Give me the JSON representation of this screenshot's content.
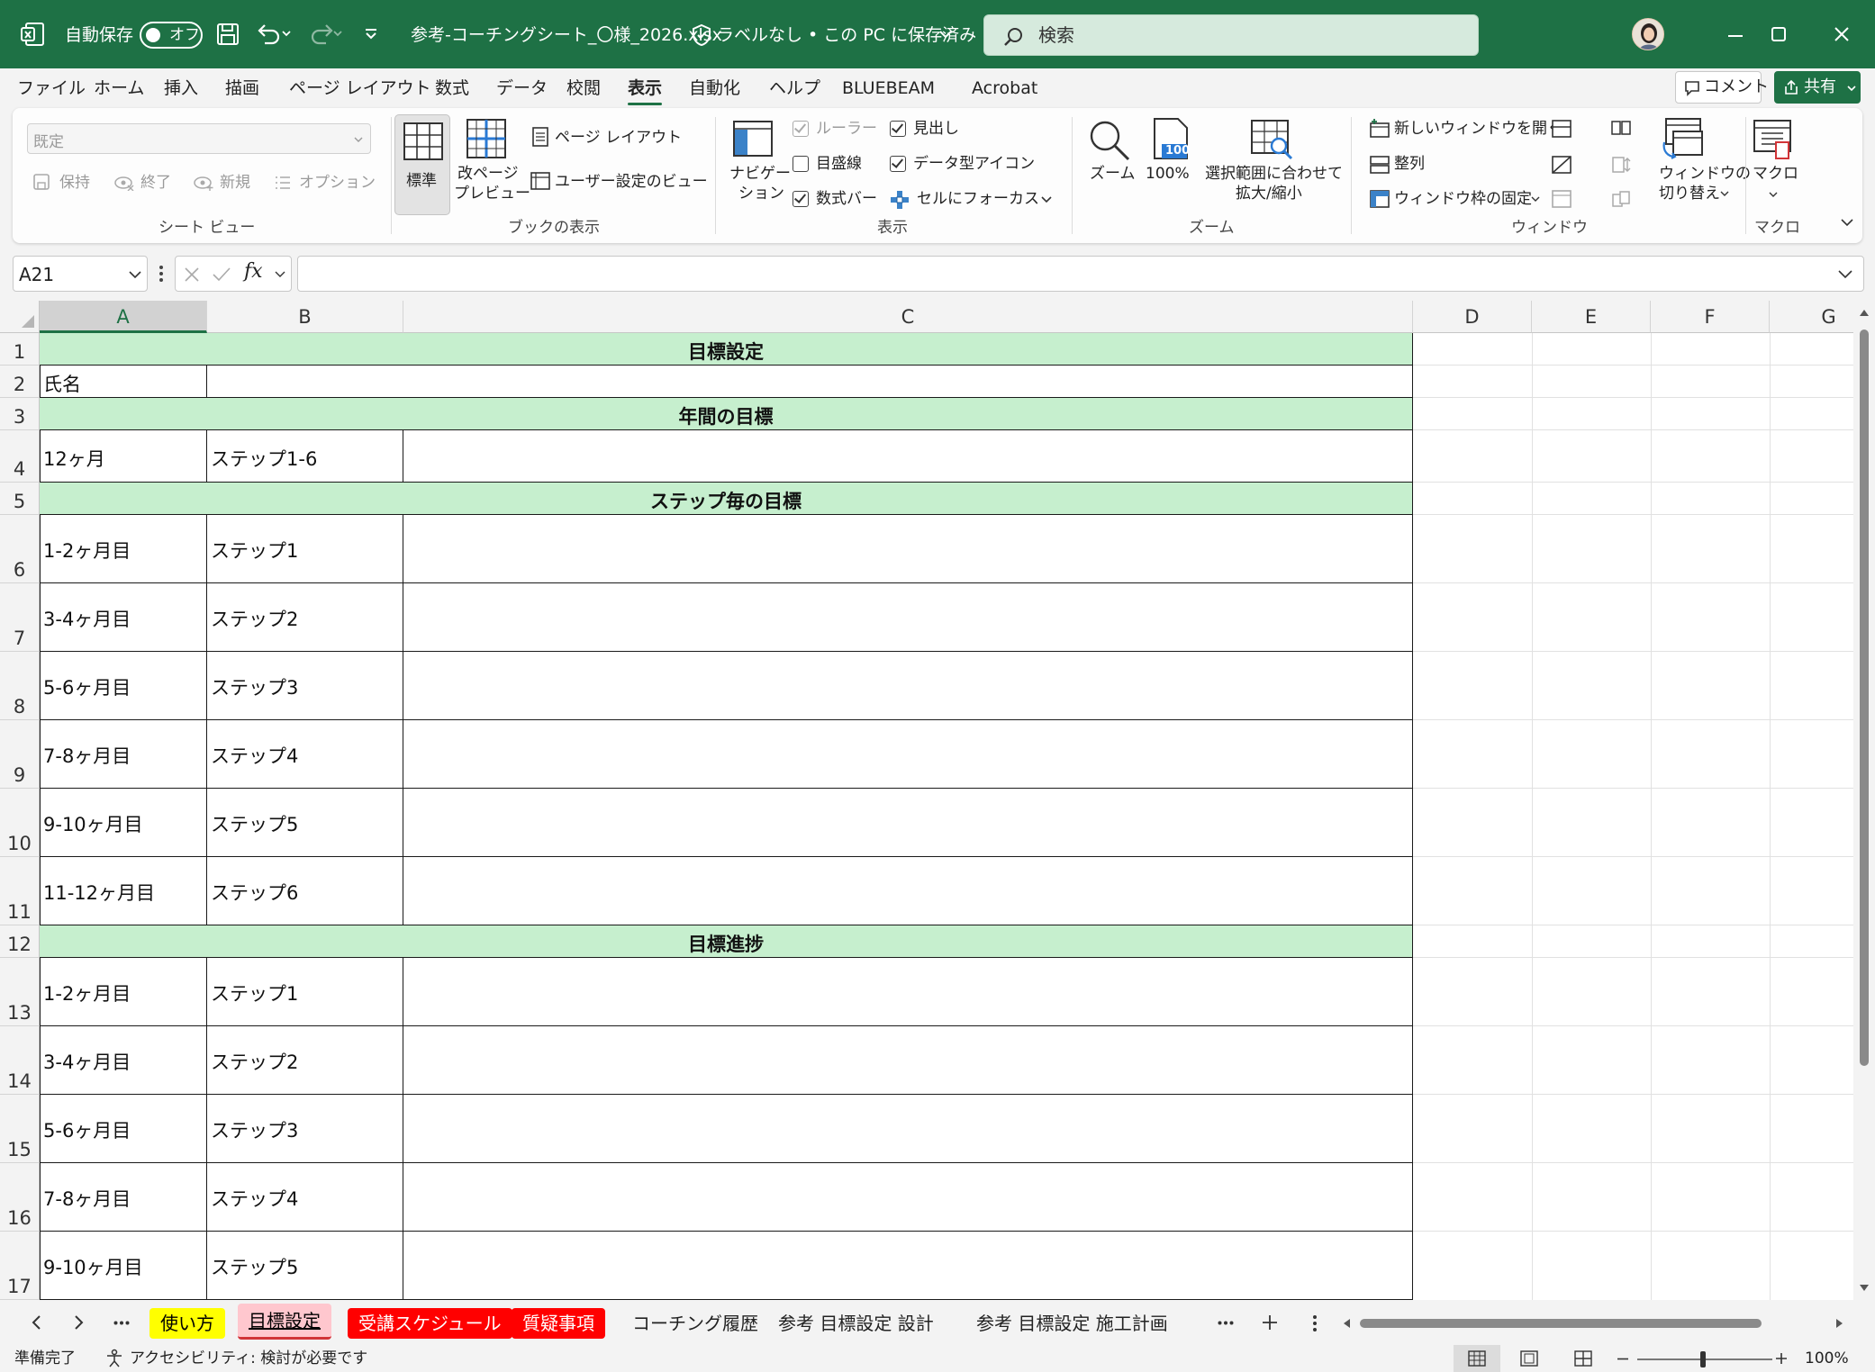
{
  "titlebar": {
    "autosave_label": "自動保存",
    "autosave_state": "オフ",
    "filename": "参考-コーチングシート_〇様_2026.xlsx",
    "label_status": "ラベルなし • この PC に保存済み",
    "search_placeholder": "検索"
  },
  "menu": {
    "items": [
      "ファイル",
      "ホーム",
      "挿入",
      "描画",
      "ページ レイアウト",
      "数式",
      "データ",
      "校閲",
      "表示",
      "自動化",
      "ヘルプ",
      "BLUEBEAM",
      "Acrobat"
    ],
    "active": "表示",
    "comment_label": "コメント",
    "share_label": "共有"
  },
  "ribbon": {
    "sheetview": {
      "dropdown_value": "既定",
      "keep": "保持",
      "exit": "終了",
      "new": "新規",
      "options": "オプション",
      "group": "シート ビュー"
    },
    "workbookviews": {
      "normal": "標準",
      "pagebreak_1": "改ページ",
      "pagebreak_2": "プレビュー",
      "pagelayout": "ページ レイアウト",
      "custom": "ユーザー設定のビュー",
      "group": "ブックの表示"
    },
    "show": {
      "nav_1": "ナビゲー",
      "nav_2": "ション",
      "ruler": "ルーラー",
      "gridlines": "目盛線",
      "formulabar": "数式バー",
      "headings": "見出し",
      "dataicon": "データ型アイコン",
      "focuscell": "セルにフォーカス",
      "group": "表示"
    },
    "zoom": {
      "zoom": "ズーム",
      "hundred": "100%",
      "icon_text": "100",
      "selection_1": "選択範囲に合わせて",
      "selection_2": "拡大/縮小",
      "group": "ズーム"
    },
    "window": {
      "newwindow": "新しいウィンドウを開く",
      "arrange": "整列",
      "freeze": "ウィンドウ枠の固定",
      "switch_1": "ウィンドウの",
      "switch_2": "切り替え",
      "group": "ウィンドウ"
    },
    "macro": {
      "macro": "マクロ",
      "group": "マクロ"
    }
  },
  "formula": {
    "namebox": "A21",
    "fx": "fx",
    "content": ""
  },
  "grid": {
    "columns": [
      "A",
      "B",
      "C",
      "D",
      "E",
      "F",
      "G"
    ],
    "selected_column": "A",
    "rows": [
      "1",
      "2",
      "3",
      "4",
      "5",
      "6",
      "7",
      "8",
      "9",
      "10",
      "11",
      "12",
      "13",
      "14",
      "15",
      "16",
      "17"
    ],
    "title": "目標設定",
    "name_label": "氏名",
    "annual_header": "年間の目標",
    "annual": {
      "a": "12ヶ月",
      "b": "ステップ1-6"
    },
    "step_header": "ステップ毎の目標",
    "steps": [
      {
        "a": "1-2ヶ月目",
        "b": "ステップ1"
      },
      {
        "a": "3-4ヶ月目",
        "b": "ステップ2"
      },
      {
        "a": "5-6ヶ月目",
        "b": "ステップ3"
      },
      {
        "a": "7-8ヶ月目",
        "b": "ステップ4"
      },
      {
        "a": "9-10ヶ月目",
        "b": "ステップ5"
      },
      {
        "a": "11-12ヶ月目",
        "b": "ステップ6"
      }
    ],
    "progress_header": "目標進捗",
    "progress": [
      {
        "a": "1-2ヶ月目",
        "b": "ステップ1"
      },
      {
        "a": "3-4ヶ月目",
        "b": "ステップ2"
      },
      {
        "a": "5-6ヶ月目",
        "b": "ステップ3"
      },
      {
        "a": "7-8ヶ月目",
        "b": "ステップ4"
      },
      {
        "a": "9-10ヶ月目",
        "b": "ステップ5"
      }
    ],
    "header_fill": "#c6efce"
  },
  "sheets": {
    "tabs": [
      {
        "label": "使い方",
        "color": "#ffff00",
        "text": "#000000"
      },
      {
        "label": "目標設定",
        "color": "#ffc7ce",
        "text": "#000000",
        "active": true
      },
      {
        "label": "受講スケジュール",
        "color": "#ff0000",
        "text": "#ffffff"
      },
      {
        "label": "質疑事項",
        "color": "#ff0000",
        "text": "#ffffff"
      },
      {
        "label": "コーチング履歴",
        "color": "",
        "text": "#222222"
      },
      {
        "label": "参考 目標設定 設計",
        "color": "",
        "text": "#222222"
      },
      {
        "label": "参考 目標設定 施工計画",
        "color": "",
        "text": "#222222"
      }
    ]
  },
  "status": {
    "ready": "準備完了",
    "accessibility": "アクセシビリティ: 検討が必要です",
    "zoom": "100%"
  },
  "colors": {
    "brand": "#1e7145",
    "header_fill": "#c6efce"
  }
}
